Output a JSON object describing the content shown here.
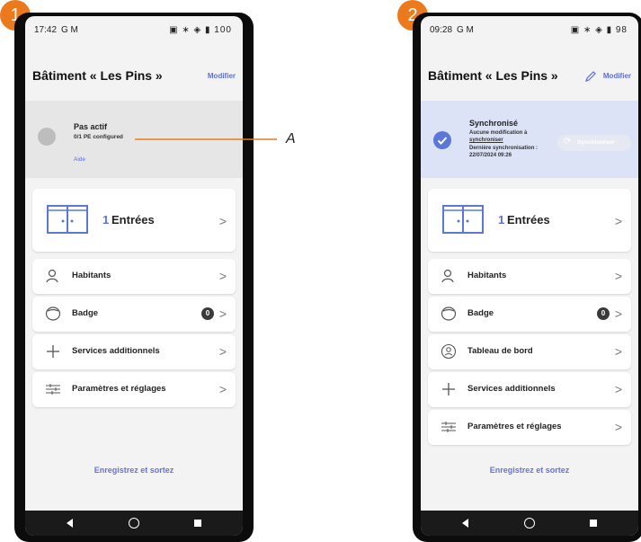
{
  "markers": {
    "m1": "1",
    "m2": "2"
  },
  "callout": {
    "label": "A"
  },
  "phone1": {
    "time": "17:42",
    "status_left_icons": "G M",
    "status_right_icons": "▣ ∗ ◈ ▮ 100",
    "title": "Bâtiment « Les Pins »",
    "modify": "Modifier",
    "status_title": "Pas actif",
    "status_detail": "0/1 PE configured",
    "help": "Aide",
    "entries_count": "1",
    "entries_label": "Entrées",
    "rows": [
      "Habitants",
      "Badge",
      "Services additionnels",
      "Paramètres et réglages"
    ],
    "badge_count": "0",
    "save": "Enregistrez et sortez"
  },
  "phone2": {
    "time": "09:28",
    "status_left_icons": "G M",
    "status_right_icons": "▣ ∗ ◈ ▮ 98",
    "title": "Bâtiment « Les Pins »",
    "modify": "Modifier",
    "status_title": "Synchronisé",
    "status_detail1": "Aucune modification à",
    "status_detail2": "synchroniser",
    "status_detail3": "Dernière synchronisation :",
    "status_detail4": "22/07/2024 09:26",
    "sync_button": "Synchroniser",
    "entries_count": "1",
    "entries_label": "Entrées",
    "rows": [
      "Habitants",
      "Badge",
      "Tableau de bord",
      "Services additionnels",
      "Paramètres et réglages"
    ],
    "badge_count": "0",
    "save": "Enregistrez et sortez"
  },
  "colors": {
    "accent": "#5b6ee1",
    "marker": "#ec7a1c",
    "sync_banner": "#dde3f7",
    "inactive_banner": "#e6e6e6"
  }
}
